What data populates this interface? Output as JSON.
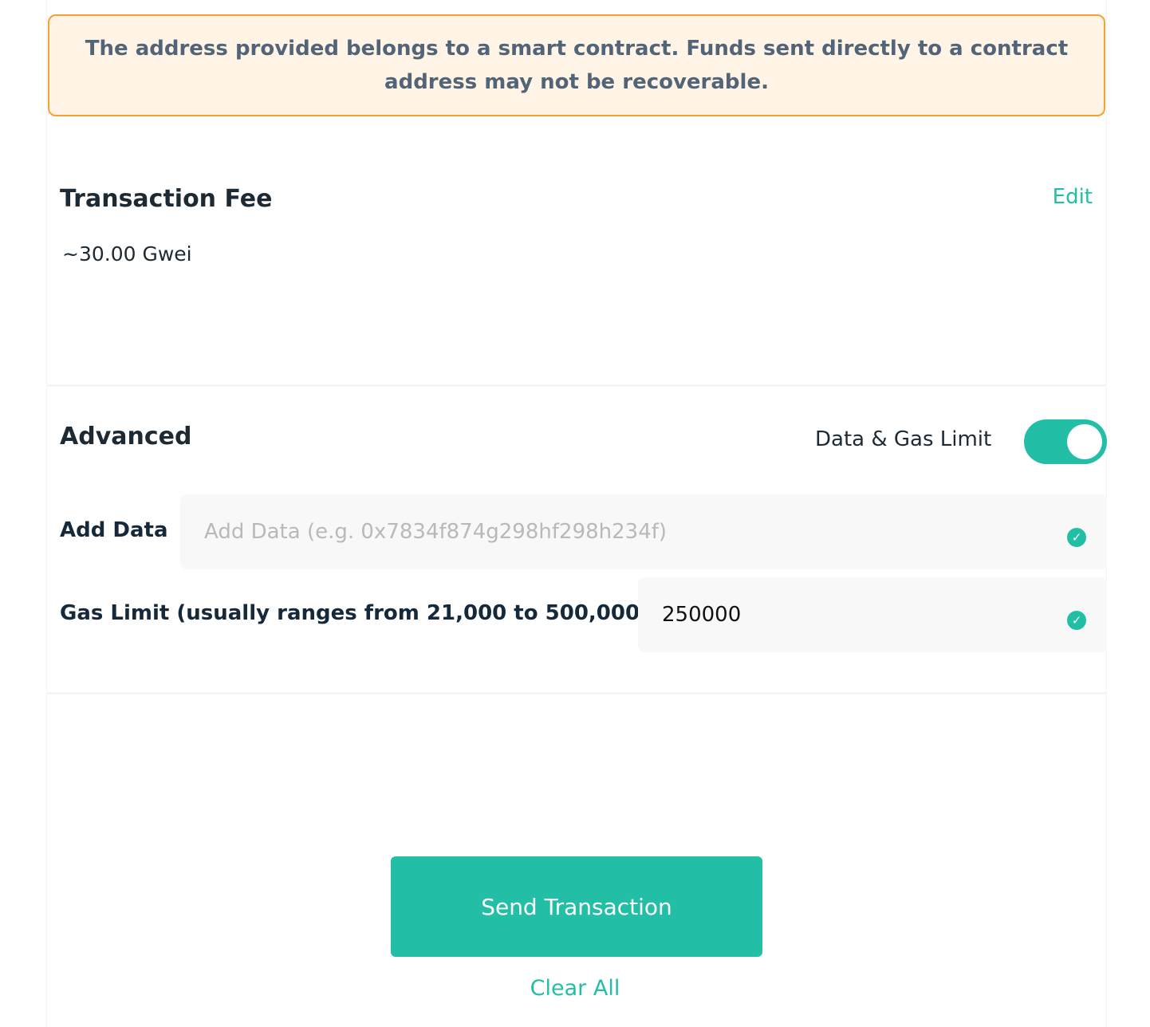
{
  "warning": {
    "text": "The address provided belongs to a smart contract. Funds sent directly to a contract address may not be recoverable."
  },
  "fee": {
    "title": "Transaction Fee",
    "edit_label": "Edit",
    "value": "~30.00 Gwei"
  },
  "advanced": {
    "title": "Advanced",
    "toggle_label": "Data & Gas Limit",
    "toggle_on": true,
    "add_data": {
      "label": "Add Data",
      "placeholder": "Add Data (e.g. 0x7834f874g298hf298h234f)",
      "value": ""
    },
    "gas_limit": {
      "label": "Gas Limit (usually ranges from 21,000 to 500,000)",
      "value": "250000"
    },
    "valid_icon": "check-circle-icon"
  },
  "actions": {
    "send_label": "Send Transaction",
    "clear_label": "Clear All"
  },
  "colors": {
    "accent": "#22bea5",
    "warning_border": "#f7a12f",
    "warning_bg": "#fff4e6"
  }
}
